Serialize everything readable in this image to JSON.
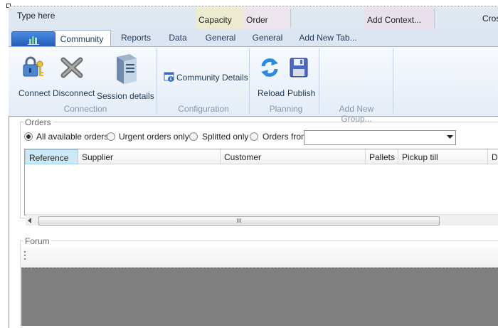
{
  "context_bar": {
    "type_here": "Type here",
    "capacity": "Capacity",
    "order": "Order",
    "add_context": "Add Context...",
    "cross": "Cros"
  },
  "tabs": [
    "Community",
    "Reports",
    "Data",
    "General",
    "General",
    "Add New Tab..."
  ],
  "ribbon": {
    "groups": {
      "connection": "Connection",
      "configuration": "Configuration",
      "planning": "Planning",
      "add_group": "Add New Group..."
    },
    "buttons": {
      "connect": "Connect",
      "disconnect": "Disconnect",
      "session_details": "Session details",
      "community_details": "Community Details",
      "reload": "Reload",
      "publish": "Publish"
    }
  },
  "orders": {
    "legend": "Orders",
    "filters": {
      "all": "All available orders",
      "urgent": "Urgent orders only",
      "splitted": "Splitted only",
      "from": "Orders from"
    },
    "combo_value": "",
    "columns": [
      "Reference",
      "Supplier",
      "Customer",
      "Pallets",
      "Pickup till",
      "De"
    ],
    "scroll_grip": "III"
  },
  "forum": {
    "legend": "Forum"
  },
  "colors": {
    "accent": "#1f5bb6",
    "ribbon_text": "#1e395b",
    "group_label": "#8595aa"
  }
}
